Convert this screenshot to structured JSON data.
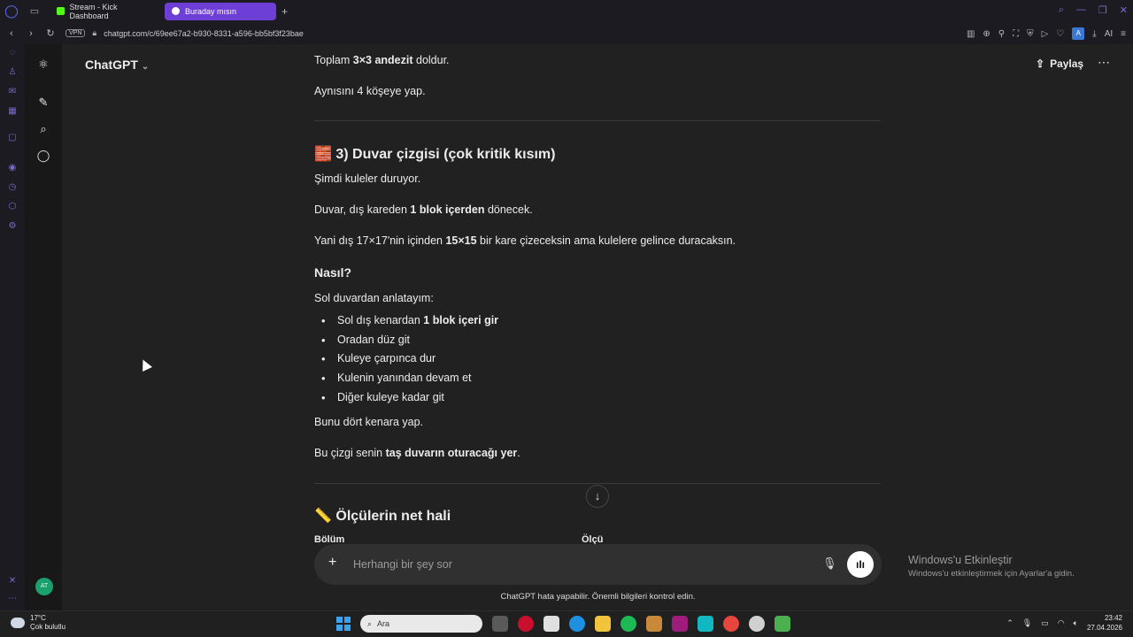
{
  "browser": {
    "tabs": [
      {
        "label": "Stream - Kick Dashboard",
        "favicon_color": "#53fc18"
      },
      {
        "label": "Buraday mısın",
        "favicon_color": "#ffffff"
      }
    ],
    "vpn_label": "VPN",
    "url": "chatgpt.com/c/69ee67a2-b930-8331-a596-bb5bf3f23bae",
    "account_initial": "A",
    "aria_label": "AI"
  },
  "app": {
    "model_title": "ChatGPT",
    "share_label": "Paylaş",
    "avatar_initials": "AT"
  },
  "message": {
    "line_toplam_pre": "Toplam ",
    "line_toplam_bold": "3×3 andezit",
    "line_toplam_post": " doldur.",
    "line_aynisi": "Aynısını 4 köşeye yap.",
    "section3_emoji": "🧱",
    "section3_title": "3) Duvar çizgisi (çok kritik kısım)",
    "p_simdi": "Şimdi kuleler duruyor.",
    "p_duvar_pre": "Duvar, dış kareden ",
    "p_duvar_bold": "1 blok içerden",
    "p_duvar_post": " dönecek.",
    "p_yani_pre": "Yani dış 17×17'nin içinden ",
    "p_yani_bold": "15×15",
    "p_yani_post": " bir kare çizeceksin ama kulelere gelince duracaksın.",
    "h_nasil": "Nasıl?",
    "p_sol": "Sol duvardan anlatayım:",
    "bullet1_pre": "Sol dış kenardan ",
    "bullet1_bold": "1 blok içeri gir",
    "bullet2": "Oradan düz git",
    "bullet3": "Kuleye çarpınca dur",
    "bullet4": "Kulenin yanından devam et",
    "bullet5": "Diğer kuleye kadar git",
    "p_bunu": "Bunu dört kenara yap.",
    "p_bu_pre": "Bu çizgi senin ",
    "p_bu_bold": "taş duvarın oturacağı yer",
    "p_bu_post": ".",
    "section4_emoji": "📏",
    "section4_title": "Ölçülerin net hali",
    "table_col1": "Bölüm",
    "table_col2": "Ölçü"
  },
  "composer": {
    "placeholder": "Herhangi bir şey sor",
    "disclaimer": "ChatGPT hata yapabilir. Önemli bilgileri kontrol edin."
  },
  "watermark": {
    "title": "Windows'u Etkinleştir",
    "subtitle": "Windows'u etkinleştirmek için Ayarlar'a gidin."
  },
  "taskbar": {
    "temperature": "17°C",
    "weather": "Çok bulutlu",
    "search_placeholder": "Ara",
    "time": "23:42",
    "date": "27.04.2026"
  }
}
